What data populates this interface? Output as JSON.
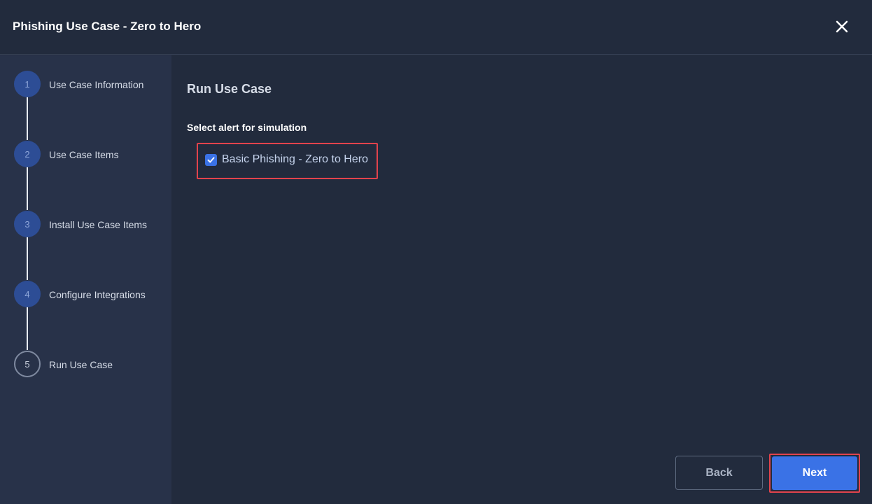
{
  "header": {
    "title": "Phishing Use Case - Zero to Hero",
    "close_icon": "close-icon"
  },
  "steps": [
    {
      "number": "1",
      "label": "Use Case Information",
      "state": "completed"
    },
    {
      "number": "2",
      "label": "Use Case Items",
      "state": "completed"
    },
    {
      "number": "3",
      "label": "Install Use Case Items",
      "state": "completed"
    },
    {
      "number": "4",
      "label": "Configure Integrations",
      "state": "completed"
    },
    {
      "number": "5",
      "label": "Run Use Case",
      "state": "current"
    }
  ],
  "main": {
    "title": "Run Use Case",
    "section_label": "Select alert for simulation",
    "alert_option": {
      "label": "Basic Phishing - Zero to Hero",
      "checked": true
    }
  },
  "footer": {
    "back_label": "Back",
    "next_label": "Next"
  },
  "colors": {
    "background": "#222b3d",
    "sidebar": "#283249",
    "accent": "#3a72e6",
    "highlight": "#e2434c"
  }
}
